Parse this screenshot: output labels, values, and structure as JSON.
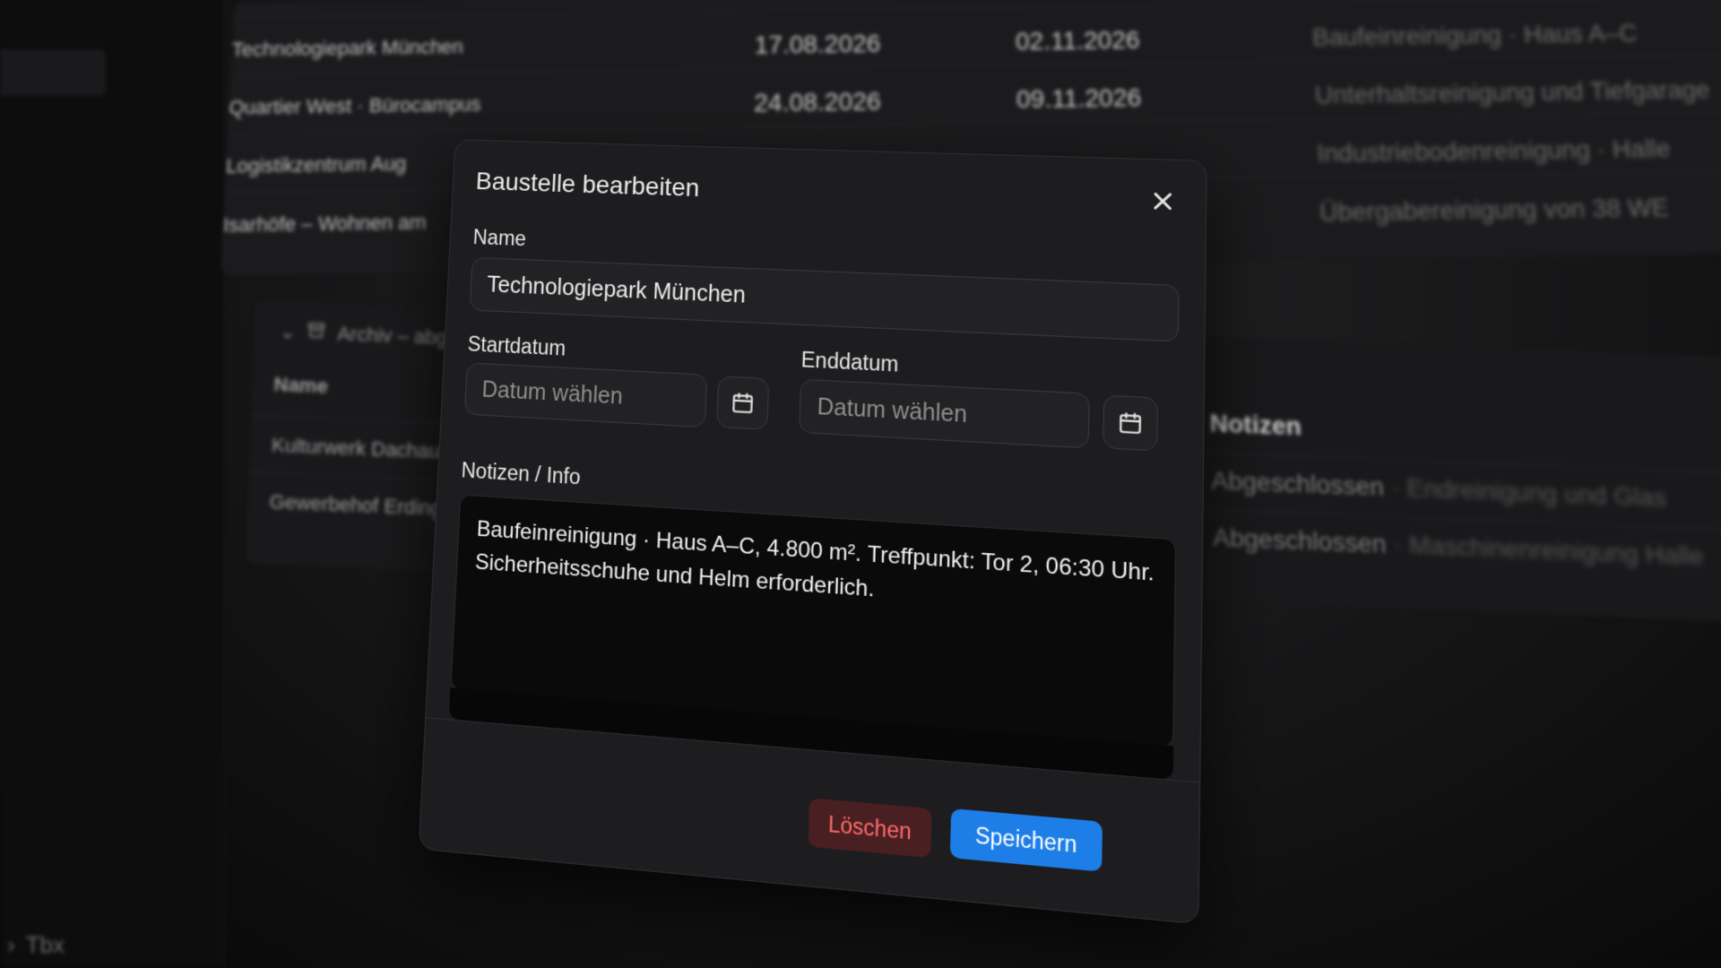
{
  "background": {
    "top_table_rows": [
      {
        "name": "Technologiepark München",
        "start": "17.08.2026",
        "end": "02.11.2026",
        "notes": "Baufeinreinigung · Haus A–C"
      },
      {
        "name": "Quartier West · Bürocampus",
        "start": "24.08.2026",
        "end": "09.11.2026",
        "notes": "Unterhaltsreinigung und Tiefgarage"
      },
      {
        "name": "Logistikzentrum Aug",
        "start": "",
        "end": "",
        "notes": "Industriebodenreinigung · Halle"
      },
      {
        "name": "Isarhöfe – Wohnen am",
        "start": "",
        "end": "",
        "notes": "Übergabereinigung von 38 WE"
      }
    ],
    "archive": {
      "title": "Archiv – abg",
      "col_name": "Name",
      "col_notes": "Notizen",
      "rows": [
        {
          "name": "Kulturwerk Dachau",
          "status": "Abgeschlossen",
          "notes_rest": "· Endreinigung und Glas"
        },
        {
          "name": "Gewerbehof Erding",
          "status": "Abgeschlossen",
          "notes_rest": "· Maschinenreinigung Halle"
        }
      ]
    },
    "sidebar_footer": "Tbx"
  },
  "dialog": {
    "title": "Baustelle bearbeiten",
    "close_icon": "close-icon",
    "name_label": "Name",
    "name_value": "Technologiepark München",
    "start_label": "Startdatum",
    "start_placeholder": "Datum wählen",
    "end_label": "Enddatum",
    "end_placeholder": "Datum wählen",
    "calendar_icon": "calendar-icon",
    "notes_label": "Notizen / Info",
    "notes_text": "Baufeinreinigung · Haus A–C, 4.800 m². Treffpunkt: Tor 2, 06:30 Uhr. Sicherheitsschuhe und Helm erforderlich.",
    "delete_label": "Löschen",
    "save_label": "Speichern"
  },
  "colors": {
    "save_button": "#1e7ee8",
    "delete_text": "#ff6b6b",
    "delete_bg": "#4a1f22",
    "dialog_bg": "#1d1d1f"
  }
}
